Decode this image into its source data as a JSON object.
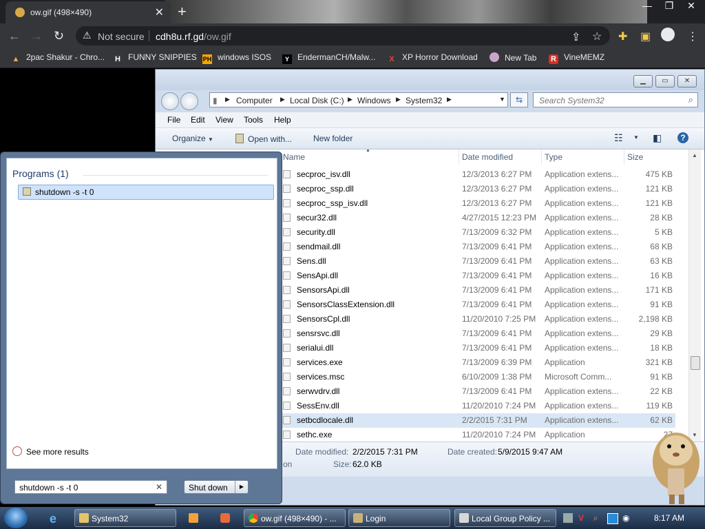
{
  "browser": {
    "tab_title": "ow.gif (498×490)",
    "security_label": "Not secure",
    "url_host": "cdh8u.rf.gd",
    "url_path": "/ow.gif",
    "bookmarks": [
      "2pac Shakur - Chro...",
      "FUNNY SNIPPIES",
      "windows ISOS",
      "EndermanCH/Malw...",
      "XP Horror Download",
      "New Tab",
      "VineMEMZ"
    ]
  },
  "explorer": {
    "breadcrumb": [
      "Computer",
      "Local Disk (C:)",
      "Windows",
      "System32"
    ],
    "search_placeholder": "Search System32",
    "menus": [
      "File",
      "Edit",
      "View",
      "Tools",
      "Help"
    ],
    "commands": {
      "organize": "Organize",
      "open_with": "Open with...",
      "new_folder": "New folder"
    },
    "columns": {
      "name": "Name",
      "date": "Date modified",
      "type": "Type",
      "size": "Size"
    },
    "files": [
      {
        "name": "secproc_isv.dll",
        "date": "12/3/2013 6:27 PM",
        "type": "Application extens...",
        "size": "475 KB"
      },
      {
        "name": "secproc_ssp.dll",
        "date": "12/3/2013 6:27 PM",
        "type": "Application extens...",
        "size": "121 KB"
      },
      {
        "name": "secproc_ssp_isv.dll",
        "date": "12/3/2013 6:27 PM",
        "type": "Application extens...",
        "size": "121 KB"
      },
      {
        "name": "secur32.dll",
        "date": "4/27/2015 12:23 PM",
        "type": "Application extens...",
        "size": "28 KB"
      },
      {
        "name": "security.dll",
        "date": "7/13/2009 6:32 PM",
        "type": "Application extens...",
        "size": "5 KB"
      },
      {
        "name": "sendmail.dll",
        "date": "7/13/2009 6:41 PM",
        "type": "Application extens...",
        "size": "68 KB"
      },
      {
        "name": "Sens.dll",
        "date": "7/13/2009 6:41 PM",
        "type": "Application extens...",
        "size": "63 KB"
      },
      {
        "name": "SensApi.dll",
        "date": "7/13/2009 6:41 PM",
        "type": "Application extens...",
        "size": "16 KB"
      },
      {
        "name": "SensorsApi.dll",
        "date": "7/13/2009 6:41 PM",
        "type": "Application extens...",
        "size": "171 KB"
      },
      {
        "name": "SensorsClassExtension.dll",
        "date": "7/13/2009 6:41 PM",
        "type": "Application extens...",
        "size": "91 KB"
      },
      {
        "name": "SensorsCpl.dll",
        "date": "11/20/2010 7:25 PM",
        "type": "Application extens...",
        "size": "2,198 KB"
      },
      {
        "name": "sensrsvc.dll",
        "date": "7/13/2009 6:41 PM",
        "type": "Application extens...",
        "size": "29 KB"
      },
      {
        "name": "serialui.dll",
        "date": "7/13/2009 6:41 PM",
        "type": "Application extens...",
        "size": "18 KB"
      },
      {
        "name": "services.exe",
        "date": "7/13/2009 6:39 PM",
        "type": "Application",
        "size": "321 KB"
      },
      {
        "name": "services.msc",
        "date": "6/10/2009 1:38 PM",
        "type": "Microsoft Comm...",
        "size": "91 KB"
      },
      {
        "name": "serwvdrv.dll",
        "date": "7/13/2009 6:41 PM",
        "type": "Application extens...",
        "size": "22 KB"
      },
      {
        "name": "SessEnv.dll",
        "date": "11/20/2010 7:24 PM",
        "type": "Application extens...",
        "size": "119 KB"
      },
      {
        "name": "setbcdlocale.dll",
        "date": "2/2/2015 7:31 PM",
        "type": "Application extens...",
        "size": "62 KB"
      },
      {
        "name": "sethc.exe",
        "date": "11/20/2010 7:24 PM",
        "type": "Application",
        "size": "27"
      }
    ],
    "details": {
      "modified_label": "Date modified:",
      "modified": "2/2/2015 7:31 PM",
      "created_label": "Date created:",
      "created": "5/9/2015 9:47 AM",
      "size_label": "Size:",
      "size": "62.0 KB",
      "partial": "on"
    }
  },
  "startmenu": {
    "programs_header": "Programs (1)",
    "program_item": "shutdown -s -t 0",
    "see_more": "See more results",
    "search_value": "shutdown -s -t 0",
    "shutdown_label": "Shut down"
  },
  "taskbar": {
    "buttons": [
      "System32",
      "ow.gif (498×490) - ...",
      "Login",
      "Local Group Policy ..."
    ],
    "clock": "8:17 AM"
  }
}
